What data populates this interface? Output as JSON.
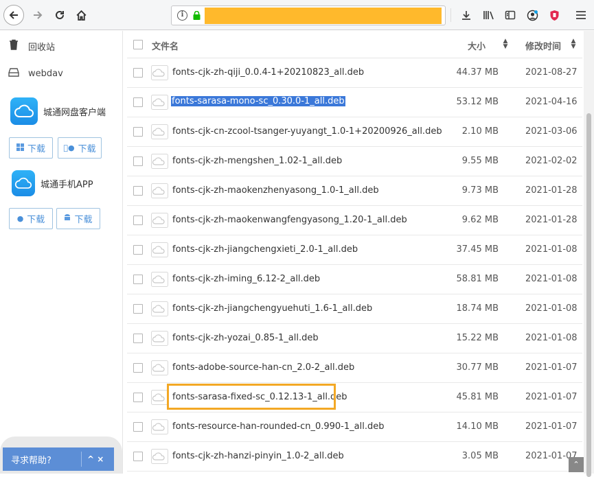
{
  "browser": {
    "icons": [
      "back-icon",
      "forward-icon",
      "reload-icon",
      "home-icon",
      "info-icon",
      "lock-icon",
      "download-icon",
      "library-icon",
      "reader-icon",
      "account-icon",
      "shield-icon",
      "menu-icon"
    ]
  },
  "sidebar": {
    "recycle_label": "回收站",
    "webdav_label": "webdav",
    "desktop_app_title": "城通网盘客户端",
    "mobile_app_title": "城通手机APP",
    "download_label": "下载",
    "help_label": "寻求帮助?",
    "help_controls": "^ ×"
  },
  "table": {
    "headers": {
      "name": "文件名",
      "size": "大小",
      "date": "修改时间"
    },
    "rows": [
      {
        "name": "fonts-cjk-zh-qiji_0.0.4-1+20210823_all.deb",
        "size": "44.37 MB",
        "date": "2021-08-27"
      },
      {
        "name": "fonts-sarasa-mono-sc_0.30.0-1_all.deb",
        "size": "53.12 MB",
        "date": "2021-04-16"
      },
      {
        "name": "fonts-cjk-cn-zcool-tsanger-yuyangt_1.0-1+20200926_all.deb",
        "size": "2.10 MB",
        "date": "2021-03-06"
      },
      {
        "name": "fonts-cjk-zh-mengshen_1.02-1_all.deb",
        "size": "9.55 MB",
        "date": "2021-02-02"
      },
      {
        "name": "fonts-cjk-zh-maokenzhenyasong_1.0-1_all.deb",
        "size": "9.73 MB",
        "date": "2021-01-28"
      },
      {
        "name": "fonts-cjk-zh-maokenwangfengyasong_1.20-1_all.deb",
        "size": "9.62 MB",
        "date": "2021-01-28"
      },
      {
        "name": "fonts-cjk-zh-jiangchengxieti_2.0-1_all.deb",
        "size": "37.45 MB",
        "date": "2021-01-08"
      },
      {
        "name": "fonts-cjk-zh-iming_6.12-2_all.deb",
        "size": "58.81 MB",
        "date": "2021-01-08"
      },
      {
        "name": "fonts-cjk-zh-jiangchengyuehuti_1.6-1_all.deb",
        "size": "18.74 MB",
        "date": "2021-01-08"
      },
      {
        "name": "fonts-cjk-zh-yozai_0.85-1_all.deb",
        "size": "15.22 MB",
        "date": "2021-01-08"
      },
      {
        "name": "fonts-adobe-source-han-cn_2.0-2_all.deb",
        "size": "30.77 MB",
        "date": "2021-01-07"
      },
      {
        "name": "fonts-sarasa-fixed-sc_0.12.13-1_all.deb",
        "size": "45.81 MB",
        "date": "2021-01-07"
      },
      {
        "name": "fonts-resource-han-rounded-cn_0.990-1_all.deb",
        "size": "14.10 MB",
        "date": "2021-01-07"
      },
      {
        "name": "fonts-cjk-zh-hanzi-pinyin_1.0-2_all.deb",
        "size": "3.05 MB",
        "date": "2021-01-07"
      }
    ]
  },
  "colors": {
    "accent": "#3b78d9",
    "highlight": "#f3a825",
    "help_bar": "#5c8ed6",
    "redaction": "#ffb92c"
  }
}
